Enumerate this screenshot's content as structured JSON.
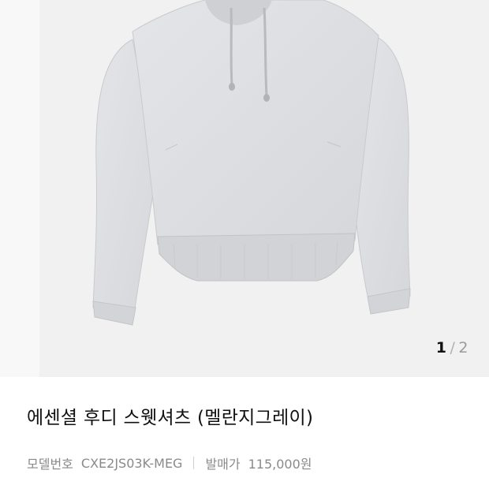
{
  "gallery": {
    "image_alt": "light gray hoodie sweatshirt",
    "pager": {
      "current": "1",
      "separator": "/",
      "total": "2"
    },
    "colors": {
      "hoodie": "#dcdde0",
      "background": "#f1f1f1"
    }
  },
  "product": {
    "title": "에센셜 후디 스웻셔츠 (멜란지그레이)",
    "model_label": "모델번호",
    "model_value": "CXE2JS03K-MEG",
    "release_price_label": "발매가",
    "release_price_value": "115,000원"
  }
}
